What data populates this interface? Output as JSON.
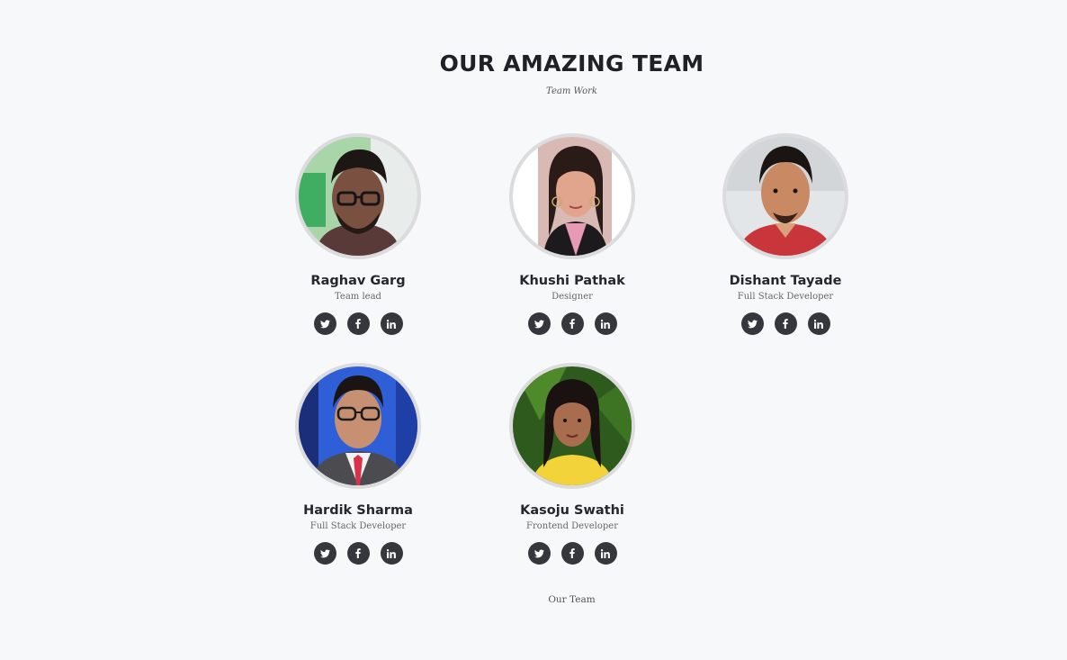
{
  "header": {
    "title": "OUR AMAZING TEAM",
    "subtitle": "Team Work"
  },
  "team": [
    {
      "name": "Raghav Garg",
      "role": "Team lead"
    },
    {
      "name": "Khushi Pathak",
      "role": "Designer"
    },
    {
      "name": "Dishant Tayade",
      "role": "Full Stack Developer"
    },
    {
      "name": "Hardik Sharma",
      "role": "Full Stack Developer"
    },
    {
      "name": "Kasoju Swathi",
      "role": "Frontend Developer"
    }
  ],
  "social_icons": [
    "twitter-icon",
    "facebook-icon",
    "linkedin-icon"
  ],
  "footer": {
    "text": "Our Team"
  },
  "colors": {
    "background": "#f7f8fa",
    "heading": "#1f2126",
    "social_button": "#34373c",
    "avatar_ring": "#dcdcdf"
  }
}
